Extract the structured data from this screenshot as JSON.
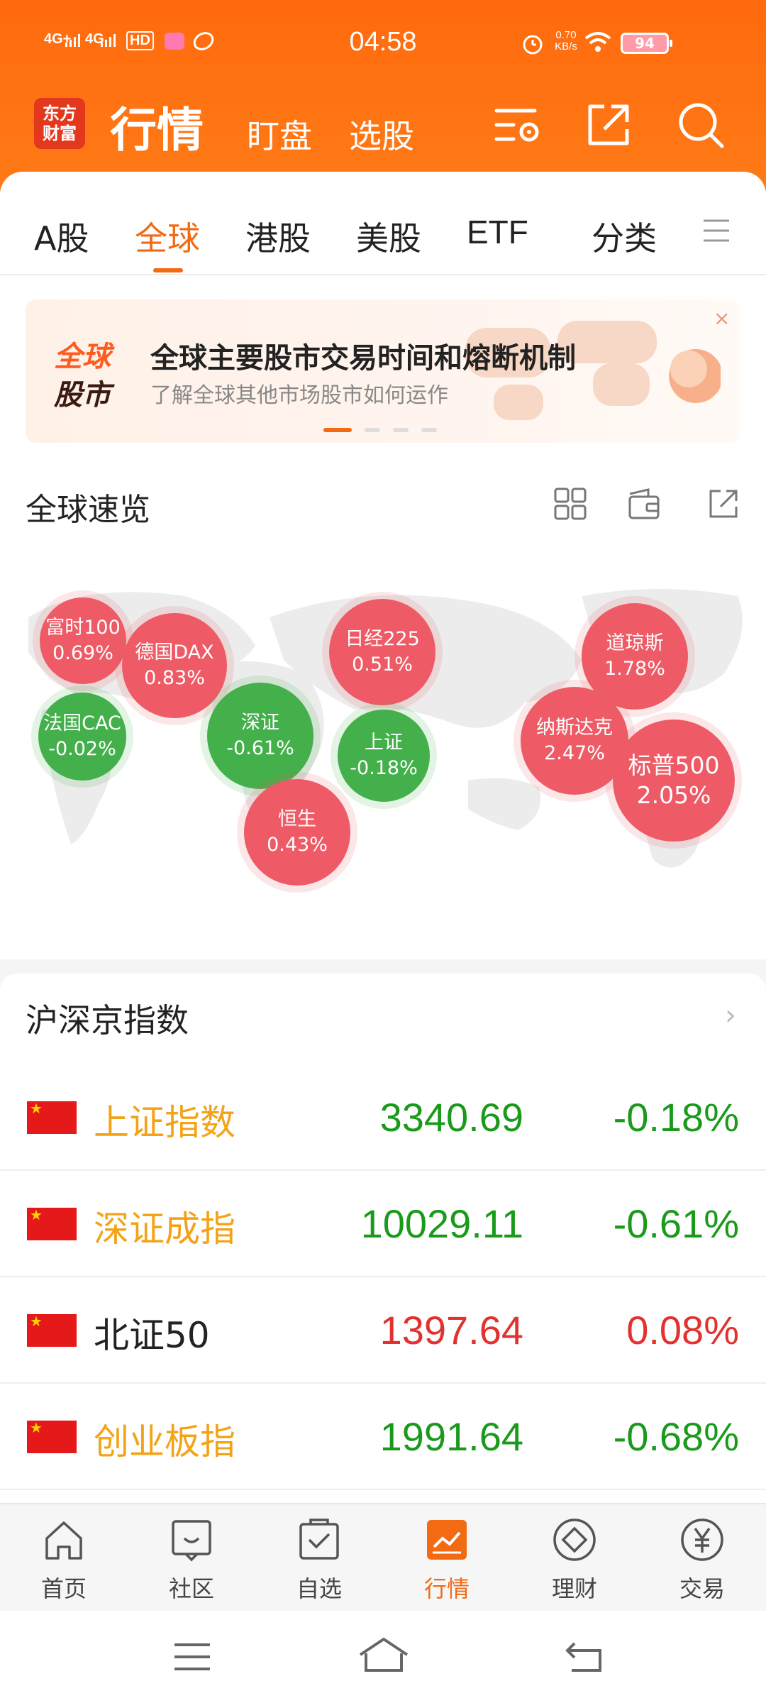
{
  "status_bar": {
    "signal1": "4G+",
    "signal2": "4G",
    "hd": "HD",
    "time": "04:58",
    "speed": "0.70 KB/s",
    "battery": "94"
  },
  "header": {
    "logo": "东方\n财富",
    "title": "行情",
    "sub_tabs": [
      "盯盘",
      "选股"
    ],
    "icons": [
      "settings-icon",
      "share-icon",
      "search-icon"
    ]
  },
  "tabs": {
    "items": [
      "A股",
      "全球",
      "港股",
      "美股",
      "ETF",
      "分类"
    ],
    "active_index": 1,
    "accent_color": "#f26a12"
  },
  "banner": {
    "badge_top": "全球",
    "badge_bottom": "股市",
    "title": "全球主要股市交易时间和熔断机制",
    "subtitle": "了解全球其他市场股市如何运作",
    "close": "×",
    "pages": 4,
    "active_page": 1
  },
  "overview": {
    "title": "全球速览",
    "bubbles": [
      {
        "name": "富时100",
        "change": "0.69%",
        "trend": "up"
      },
      {
        "name": "德国DAX",
        "change": "0.83%",
        "trend": "up"
      },
      {
        "name": "日经225",
        "change": "0.51%",
        "trend": "up"
      },
      {
        "name": "道琼斯",
        "change": "1.78%",
        "trend": "up"
      },
      {
        "name": "法国CAC",
        "change": "-0.02%",
        "trend": "down"
      },
      {
        "name": "深证",
        "change": "-0.61%",
        "trend": "down"
      },
      {
        "name": "上证",
        "change": "-0.18%",
        "trend": "down"
      },
      {
        "name": "纳斯达克",
        "change": "2.47%",
        "trend": "up"
      },
      {
        "name": "标普500",
        "change": "2.05%",
        "trend": "up"
      },
      {
        "name": "恒生",
        "change": "0.43%",
        "trend": "up"
      }
    ],
    "colors": {
      "up": "#ee5b66",
      "down": "#43b04b"
    }
  },
  "indices": {
    "title": "沪深京指数",
    "rows": [
      {
        "name": "上证指数",
        "price": "3340.69",
        "change": "-0.18%",
        "name_color": "#f3a317",
        "value_color": "#1a9a1a"
      },
      {
        "name": "深证成指",
        "price": "10029.11",
        "change": "-0.61%",
        "name_color": "#f3a317",
        "value_color": "#1a9a1a"
      },
      {
        "name": "北证50",
        "price": "1397.64",
        "change": "0.08%",
        "name_color": "#222222",
        "value_color": "#e2312e"
      },
      {
        "name": "创业板指",
        "price": "1991.64",
        "change": "-0.68%",
        "name_color": "#f3a317",
        "value_color": "#1a9a1a"
      }
    ]
  },
  "bottom_nav": {
    "items": [
      {
        "label": "首页",
        "icon": "home-icon"
      },
      {
        "label": "社区",
        "icon": "community-icon"
      },
      {
        "label": "自选",
        "icon": "watchlist-icon"
      },
      {
        "label": "行情",
        "icon": "market-icon"
      },
      {
        "label": "理财",
        "icon": "wealth-icon"
      },
      {
        "label": "交易",
        "icon": "trade-icon"
      }
    ],
    "active_index": 3
  }
}
